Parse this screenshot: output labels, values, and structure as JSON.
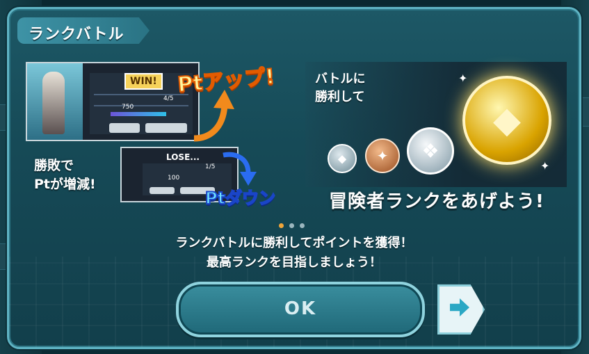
{
  "modal": {
    "title": "ランクバトル",
    "tutorial": {
      "win_badge": "WIN!",
      "win_stat_1": "4/5",
      "win_stat_2": "750",
      "lose_badge": "LOSE...",
      "lose_stat_1": "1/5",
      "lose_stat_2": "100",
      "pt_up": "Ptアップ!",
      "pt_down": "Ptダウン",
      "lose_caption_1": "勝敗で",
      "lose_caption_2": "Ptが増減!",
      "medal_caption_1": "バトルに",
      "medal_caption_2": "勝利して",
      "rank_caption": "冒険者ランクをあげよう!"
    },
    "pager": {
      "total": 3,
      "active_index": 0
    },
    "description_line_1": "ランクバトルに勝利してポイントを獲得！",
    "description_line_2": "最高ランクを目指しましょう！",
    "ok_label": "OK",
    "next_icon": "arrow-right-icon"
  },
  "colors": {
    "accent": "#5fb4c4",
    "pager_active": "#f0a53a",
    "pt_up": "#fff7a0",
    "pt_down": "#6fe2ff"
  }
}
